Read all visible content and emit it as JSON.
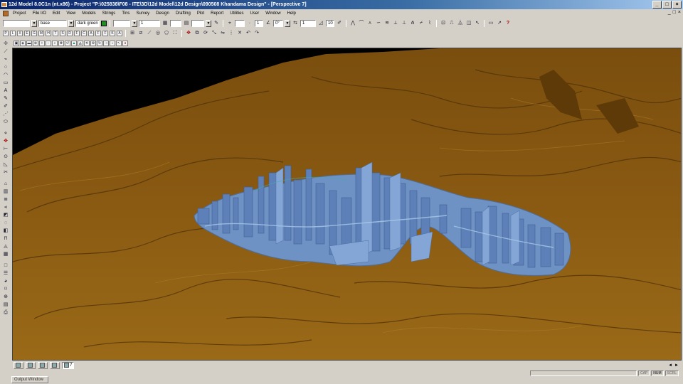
{
  "window": {
    "title": "12d Model 8.0C1n (nt.x86) - Project \"P:\\025838\\F08 - ITE\\3D\\12d Model\\12d Design\\090508 Khandama Design\" - [Perspective 7]",
    "buttons": [
      "_",
      "□",
      "×"
    ]
  },
  "menu": {
    "items": [
      "Project",
      "File I/O",
      "Edit",
      "View",
      "Models",
      "Strings",
      "Tins",
      "Survey",
      "Design",
      "Drafting",
      "Plot",
      "Report",
      "Utilities",
      "User",
      "Window",
      "Help"
    ],
    "mdi_buttons": [
      "_",
      "□",
      "×"
    ]
  },
  "toolbar1": {
    "name_value": "",
    "model_value": "base",
    "colour_value": "dark green",
    "colour_hex": "#1f8f1f",
    "weight_value": "1",
    "chainage_value": "",
    "angle_value": "0°",
    "count_value": "1",
    "offset_value": "1",
    "tin_value": "10"
  },
  "toolbar2": {
    "letters": [
      "P",
      "L",
      "X",
      "E",
      "G",
      "M",
      "H",
      "T",
      "S",
      "D",
      "F",
      "C",
      "A",
      "F",
      "F",
      "K",
      "A"
    ]
  },
  "window_tabs": [
    {
      "label": "",
      "active": false
    },
    {
      "label": "",
      "active": false
    },
    {
      "label": "",
      "active": false
    },
    {
      "label": "",
      "active": false
    },
    {
      "label": "7",
      "active": true
    }
  ],
  "status": {
    "panels": [
      "CAP",
      "NUM",
      "SCRL"
    ],
    "num_active": true,
    "arrows": [
      "◄",
      "►"
    ]
  },
  "output_tab": "Output Window",
  "colors": {
    "terrain": "#8a5a12",
    "terrain_light": "#a87a22",
    "design_blue": "#6f92c4",
    "sky": "#000000"
  }
}
